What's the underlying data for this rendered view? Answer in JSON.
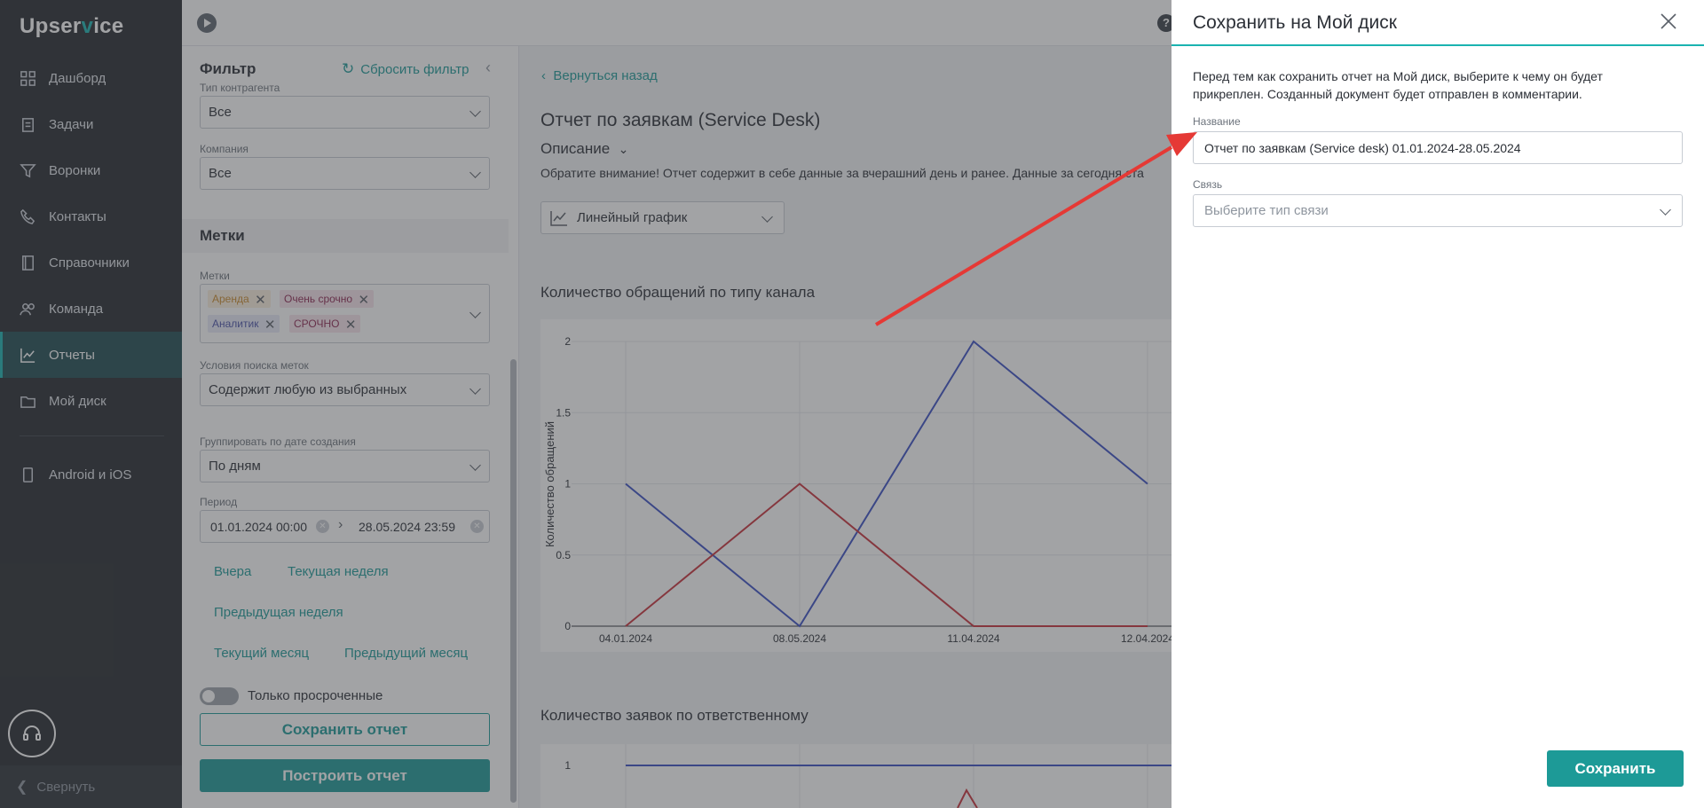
{
  "app": {
    "logo_prefix": "Upser",
    "logo_accent": "v",
    "logo_suffix": "ice"
  },
  "sidebar": {
    "items": [
      {
        "label": "Дашборд",
        "icon": "dashboard-icon"
      },
      {
        "label": "Задачи",
        "icon": "tasks-icon"
      },
      {
        "label": "Воронки",
        "icon": "funnel-icon"
      },
      {
        "label": "Контакты",
        "icon": "phone-icon"
      },
      {
        "label": "Справочники",
        "icon": "book-icon"
      },
      {
        "label": "Команда",
        "icon": "team-icon"
      },
      {
        "label": "Отчеты",
        "icon": "chart-icon",
        "active": true
      },
      {
        "label": "Мой диск",
        "icon": "folder-icon"
      }
    ],
    "mobile_label": "Android и iOS",
    "collapse_label": "Свернуть"
  },
  "filter": {
    "title": "Фильтр",
    "reset_label": "Сбросить фильтр",
    "contractor_type_label": "Тип контрагента",
    "contractor_type_value": "Все",
    "company_label": "Компания",
    "company_value": "Все",
    "tags_section": "Метки",
    "tags_label": "Метки",
    "tags": [
      "Аренда",
      "Очень срочно",
      "Аналитик",
      "СРОЧНО"
    ],
    "tag_search_label": "Условия поиска меток",
    "tag_search_value": "Содержит любую из выбранных",
    "group_label": "Группировать по дате создания",
    "group_value": "По дням",
    "period_label": "Период",
    "period_from": "01.01.2024 00:00",
    "period_to": "28.05.2024 23:59",
    "quick_links": [
      "Вчера",
      "Текущая неделя",
      "Предыдущая неделя",
      "Текущий месяц",
      "Предыдущий месяц"
    ],
    "overdue_label": "Только просроченные",
    "save_report_label": "Сохранить отчет",
    "build_report_label": "Построить отчет"
  },
  "main": {
    "back_label": "Вернуться назад",
    "title": "Отчет по заявкам (Service Desk)",
    "description_toggle": "Описание",
    "description_text": "Обратите внимание! Отчет содержит в себе данные за вчерашний день и ранее. Данные за сегодня ста",
    "chart_type_value": "Линейный график",
    "chart1_title": "Количество обращений по типу канала",
    "chart2_title": "Количество заявок по ответственному"
  },
  "chart_data": [
    {
      "type": "line",
      "title": "Количество обращений по типу канала",
      "ylabel": "Количество обращений",
      "xlabel": "",
      "categories": [
        "04.01.2024",
        "08.05.2024",
        "11.04.2024",
        "12.04.2024"
      ],
      "ylim": [
        0,
        2
      ],
      "yticks": [
        "0",
        "0.5",
        "1",
        "1.5",
        "2"
      ],
      "grid": true,
      "series": [
        {
          "values": [
            1,
            0,
            2,
            1
          ],
          "color": "#3a4fc4"
        },
        {
          "values": [
            0,
            1,
            0,
            0
          ],
          "color": "#c8303a"
        }
      ]
    },
    {
      "type": "line",
      "title": "Количество заявок по ответственному",
      "yticks": [
        "1"
      ]
    }
  ],
  "modal": {
    "title": "Сохранить на Мой диск",
    "description": "Перед тем как сохранить отчет на Мой диск, выберите к чему он будет прикреплен. Созданный документ будет отправлен в комментарии.",
    "name_label": "Название",
    "name_value": "Отчет по заявкам (Service desk) 01.01.2024-28.05.2024",
    "link_label": "Связь",
    "link_placeholder": "Выберите тип связи",
    "save_label": "Сохранить"
  },
  "colors": {
    "accent": "#1d9a97",
    "annotation_arrow": "#e53935",
    "sidebar_bg": "#262a2f"
  }
}
